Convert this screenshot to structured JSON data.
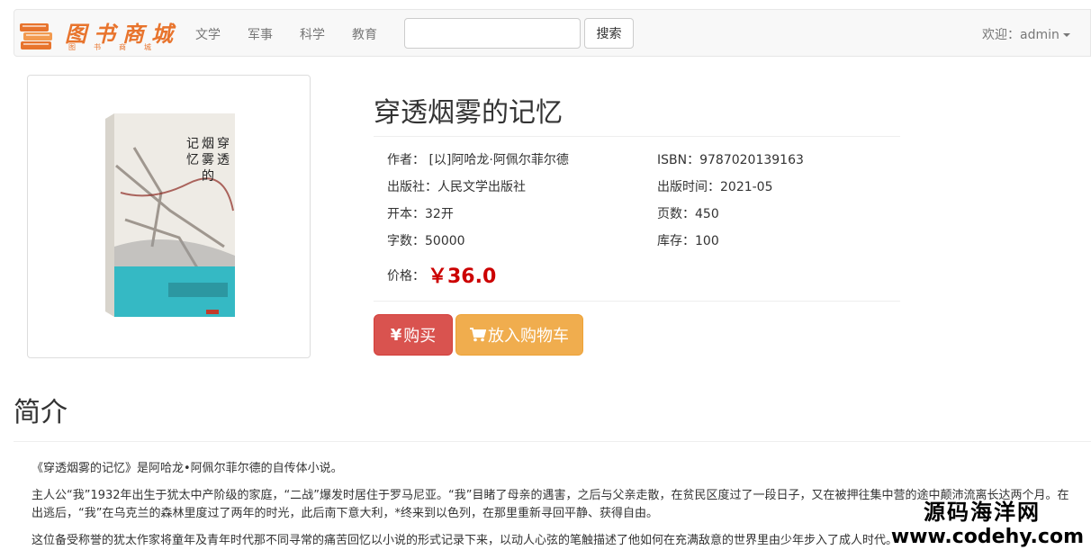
{
  "brand": {
    "title": "图书商城",
    "subtitle": "图书商城"
  },
  "nav": {
    "items": [
      "文学",
      "军事",
      "科学",
      "教育"
    ]
  },
  "search": {
    "value": "",
    "placeholder": "",
    "button_label": "搜索"
  },
  "user": {
    "welcome": "欢迎：admin"
  },
  "cover": {
    "title_chars": "穿透烟雾的记忆"
  },
  "book": {
    "title": "穿透烟雾的记忆",
    "author": "作者：  [以]阿哈龙·阿佩尔菲尔德",
    "isbn": "ISBN：9787020139163",
    "publisher": "出版社：人民文学出版社",
    "pubdate": "出版时间：2021-05",
    "format": "开本：32开",
    "pages": "页数：450",
    "words": "字数：50000",
    "stock": "库存：100",
    "price_label": "价格：",
    "price": "￥36.0"
  },
  "actions": {
    "buy_label": "购买",
    "cart_label": "放入购物车"
  },
  "intro": {
    "heading": "简介",
    "paragraphs": [
      "《穿透烟雾的记忆》是阿哈龙•阿佩尔菲尔德的自传体小说。",
      "主人公“我”1932年出生于犹太中产阶级的家庭，“二战”爆发时居住于罗马尼亚。“我”目睹了母亲的遇害，之后与父亲走散，在贫民区度过了一段日子，又在被押往集中营的途中颠沛流离长达两个月。在出逃后，“我”在乌克兰的森林里度过了两年的时光，此后南下意大利，*终来到以色列，在那里重新寻回平静、获得自由。",
      "这位备受称誉的犹太作家将童年及青年时代那不同寻常的痛苦回忆以小说的形式记录下来，以动人心弦的笔触描述了他如何在充满敌意的世界里由少年步入了成人时代。"
    ]
  },
  "watermark": {
    "cn": "源码海洋网",
    "url": "www.codehy.com"
  },
  "colors": {
    "price": "#cc0000",
    "buy": "#d9534f",
    "cart": "#f0ad4e",
    "brand": "#e8742d"
  }
}
